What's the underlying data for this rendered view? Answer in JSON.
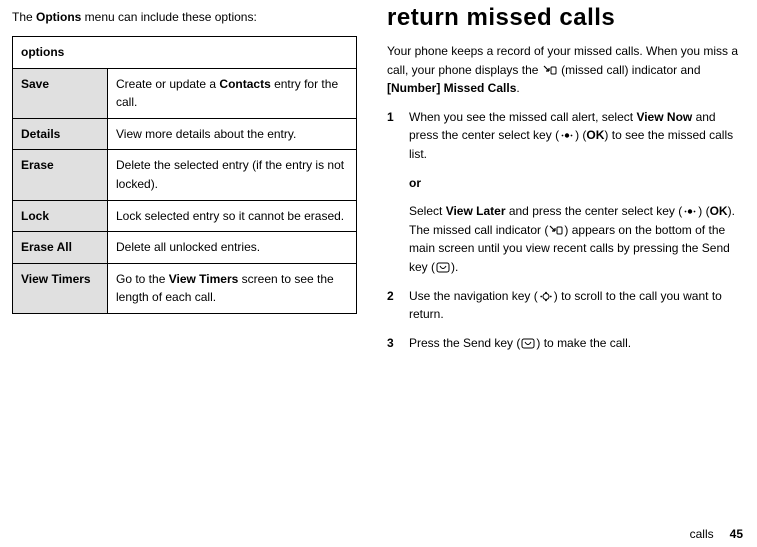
{
  "left": {
    "intro_pre": "The ",
    "intro_menu": "Options",
    "intro_post": " menu can include these options:",
    "header": "options",
    "rows": [
      {
        "name": "Save",
        "desc_pre": "Create or update a ",
        "desc_bold": "Contacts",
        "desc_post": " entry for the call."
      },
      {
        "name": "Details",
        "desc_pre": "View more details about the entry.",
        "desc_bold": "",
        "desc_post": ""
      },
      {
        "name": "Erase",
        "desc_pre": "Delete the selected entry (if the entry is not locked).",
        "desc_bold": "",
        "desc_post": ""
      },
      {
        "name": "Lock",
        "desc_pre": "Lock selected entry so it cannot be erased.",
        "desc_bold": "",
        "desc_post": ""
      },
      {
        "name": "Erase All",
        "desc_pre": "Delete all unlocked entries.",
        "desc_bold": "",
        "desc_post": ""
      },
      {
        "name": "View Timers",
        "desc_pre": "Go to the ",
        "desc_bold": "View Timers",
        "desc_post": " screen to see the length of each call."
      }
    ]
  },
  "right": {
    "heading": "return missed calls",
    "p1_a": "Your phone keeps a record of your missed calls. When you miss a call, your phone displays the ",
    "p1_b": " (missed call) indicator and ",
    "p1_bold": "[Number] Missed Calls",
    "p1_c": ".",
    "step1_a": "When you see the missed call alert, select ",
    "step1_bold1": "View Now",
    "step1_b": " and press the center select key (",
    "step1_c": ") (",
    "step1_bold2": "OK",
    "step1_d": ") to see the missed calls list.",
    "or": "or",
    "step1alt_a": "Select ",
    "step1alt_bold1": "View Later",
    "step1alt_b": " and press the center select key (",
    "step1alt_c": ") (",
    "step1alt_bold2": "OK",
    "step1alt_d": "). The missed call indicator (",
    "step1alt_e": ") appears on the bottom of the main screen until you view recent calls by pressing the Send key (",
    "step1alt_f": ").",
    "step2_a": "Use the navigation key (",
    "step2_b": ") to scroll to the call you want to return.",
    "step3_a": "Press the Send key (",
    "step3_b": ") to make the call.",
    "n1": "1",
    "n2": "2",
    "n3": "3",
    "footer_label": "calls",
    "footer_page": "45"
  }
}
